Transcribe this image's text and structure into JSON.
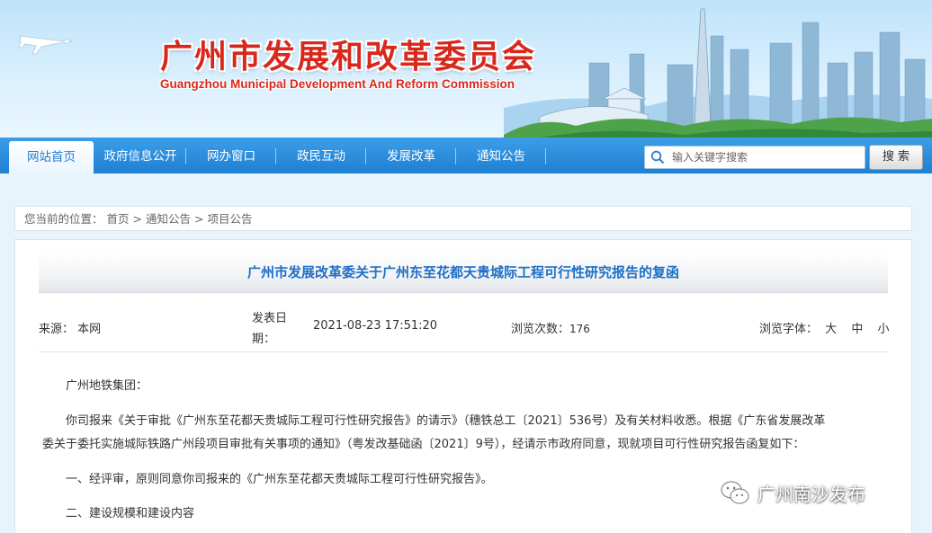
{
  "banner": {
    "title": "广州市发展和改革委员会",
    "subtitle": "Guangzhou Municipal Development And Reform Commission",
    "title_color": "#d8281c"
  },
  "nav": {
    "items": [
      {
        "label": "网站首页",
        "active": true
      },
      {
        "label": "政府信息公开",
        "active": false
      },
      {
        "label": "网办窗口",
        "active": false
      },
      {
        "label": "政民互动",
        "active": false
      },
      {
        "label": "发展改革",
        "active": false
      },
      {
        "label": "通知公告",
        "active": false
      }
    ],
    "accent": "#1f7fd2"
  },
  "search": {
    "placeholder": "输入关键字搜索",
    "button_label": "搜 索",
    "icon": "search-icon"
  },
  "breadcrumb": {
    "prefix": "您当前的位置：",
    "items": [
      "首页",
      "通知公告",
      "项目公告"
    ],
    "separator": ">"
  },
  "article": {
    "title": "广州市发展改革委关于广州东至花都天贵城际工程可行性研究报告的复函",
    "source_label": "来源：",
    "source_value": "本网",
    "date_label_line1": "发表日",
    "date_label_line2": "期：",
    "date_value": "2021-08-23 17:51:20",
    "views_label": "浏览次数：",
    "views_value": "176",
    "font_label": "浏览字体：",
    "font_large": "大",
    "font_medium": "中",
    "font_small": "小",
    "paragraphs": [
      "广州地铁集团：",
      "你司报来《关于审批《广州东至花都天贵城际工程可行性研究报告》的请示》（穗铁总工〔2021〕536号）及有关材料收悉。根据《广东省发展改革",
      "委关于委托实施城际铁路广州段项目审批有关事项的通知》（粤发改基础函〔2021〕9号），经请示市政府同意，现就项目可行性研究报告函复如下：",
      "一、经评审，原则同意你司报来的《广州东至花都天贵城际工程可行性研究报告》。",
      "二、建设规模和建设内容"
    ]
  },
  "watermark": {
    "text": "广州南沙发布",
    "icon": "wechat-icon"
  }
}
